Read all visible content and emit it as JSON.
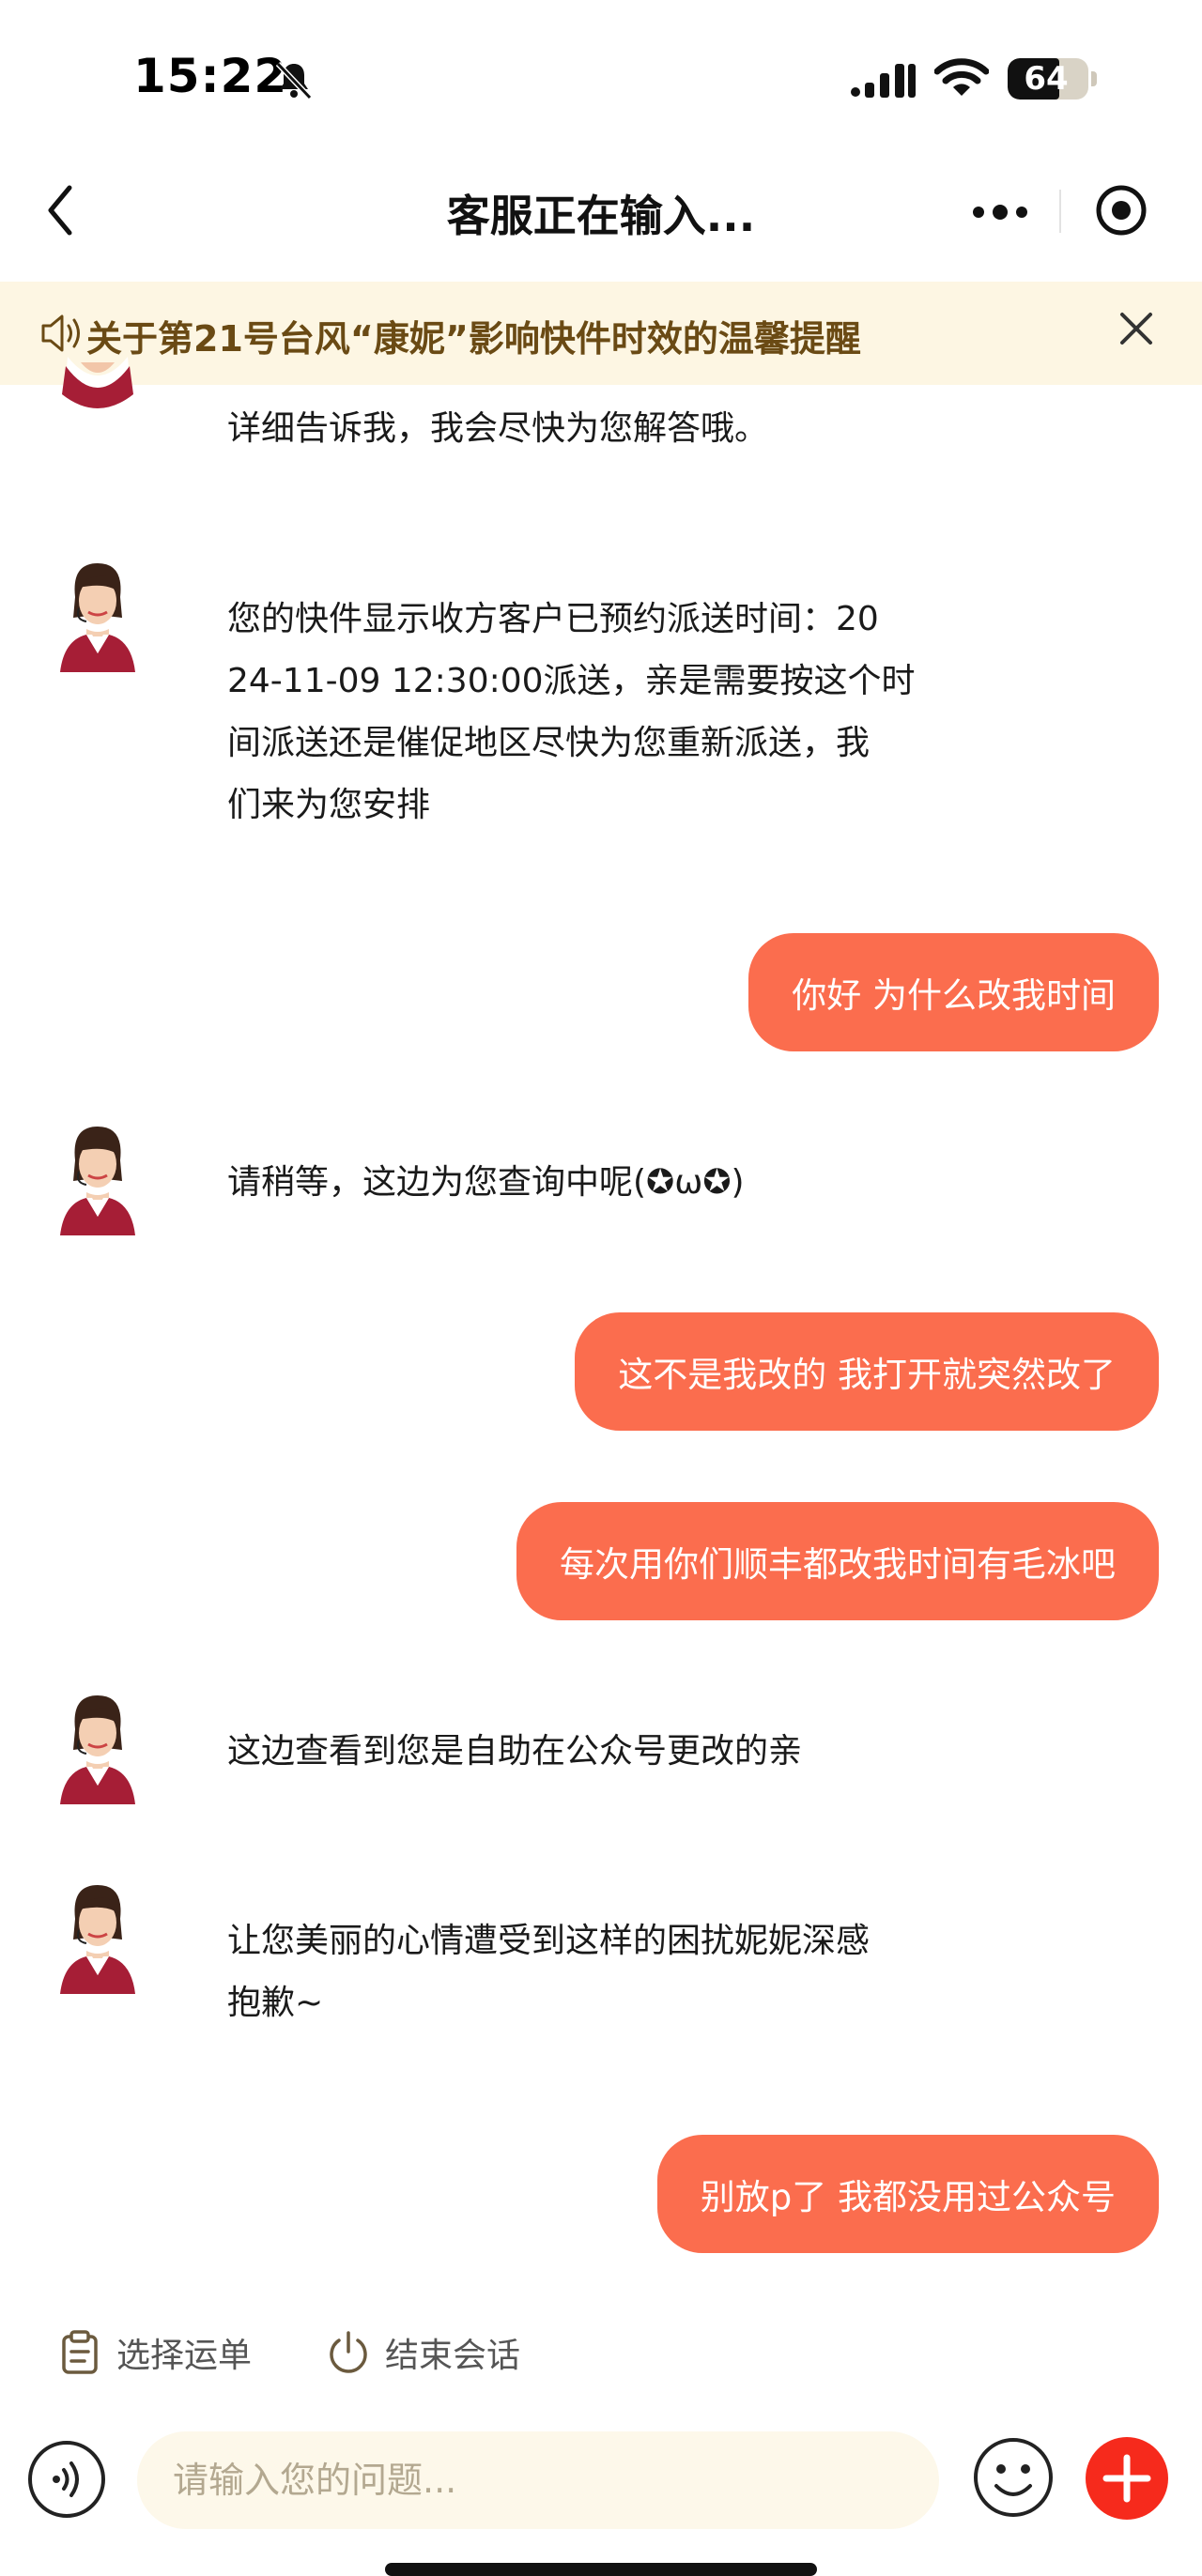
{
  "status_bar": {
    "time": "15:22",
    "battery": "64",
    "battery_level": 0.64,
    "icons": [
      "bell-muted-icon",
      "signal-icon",
      "wifi-icon",
      "battery-icon"
    ]
  },
  "nav": {
    "title": "客服正在输入...",
    "icons": [
      "back-icon",
      "more-icon",
      "target-icon"
    ]
  },
  "notice": {
    "text": "关于第21号台风“康妮”影响快件时效的温馨提醒",
    "icons": [
      "speaker-icon",
      "close-icon"
    ]
  },
  "messages": [
    {
      "sender": "agent",
      "text": "详细告诉我，我会尽快为您解答哦。"
    },
    {
      "sender": "agent",
      "lines": [
        "您的快件显示收方客户已预约派送时间：20",
        "24-11-09 12:30:00派送，亲是需要按这个时",
        "间派送还是催促地区尽快为您重新派送，我",
        "们来为您安排"
      ]
    },
    {
      "sender": "user",
      "text": "你好 为什么改我时间"
    },
    {
      "sender": "agent",
      "text": "请稍等，这边为您查询中呢(✪ω✪)"
    },
    {
      "sender": "user",
      "text": "这不是我改的 我打开就突然改了"
    },
    {
      "sender": "user",
      "text": "每次用你们顺丰都改我时间有毛冰吧"
    },
    {
      "sender": "agent",
      "text": "这边查看到您是自助在公众号更改的亲"
    },
    {
      "sender": "agent",
      "lines": [
        "让您美丽的心情遭受到这样的困扰妮妮深感",
        "抱歉~"
      ]
    },
    {
      "sender": "user",
      "text": "别放p了 我都没用过公众号"
    }
  ],
  "quick_actions": {
    "select_waybill": "选择运单",
    "end_session": "结束会话"
  },
  "input": {
    "placeholder": "请输入您的问题..."
  },
  "colors": {
    "user_bubble": "#fb6d4e",
    "notice_bg": "#fdf6e3",
    "notice_text": "#6a4a14",
    "plus_button": "#f62a1c"
  }
}
